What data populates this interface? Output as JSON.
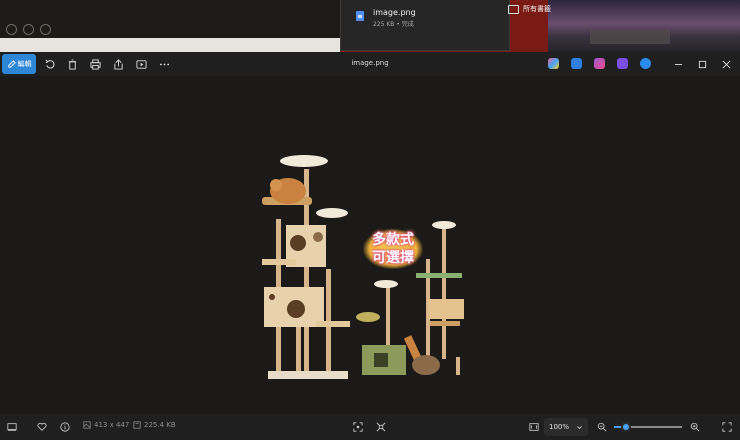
{
  "download": {
    "file_name": "image.png",
    "meta": "225 KB • 完成",
    "folder_label": "所有書籤"
  },
  "toolbar": {
    "edit_label": "編輯",
    "title": "image.png",
    "icons": [
      "rotate-icon",
      "delete-icon",
      "print-icon",
      "share-icon",
      "slideshow-icon",
      "more-icon"
    ],
    "app_colors": [
      "#e74c8a",
      "#2f7fe0",
      "#9b59d0",
      "#7a4ee0",
      "#2a8cf0"
    ]
  },
  "image": {
    "promo_line1": "多款式",
    "promo_line2": "可選擇"
  },
  "statusbar": {
    "dimensions": "413 x 447",
    "file_size": "225.4 KB",
    "zoom": "100%",
    "zoom_level": 0.18,
    "accent": "#4aa0f0"
  }
}
